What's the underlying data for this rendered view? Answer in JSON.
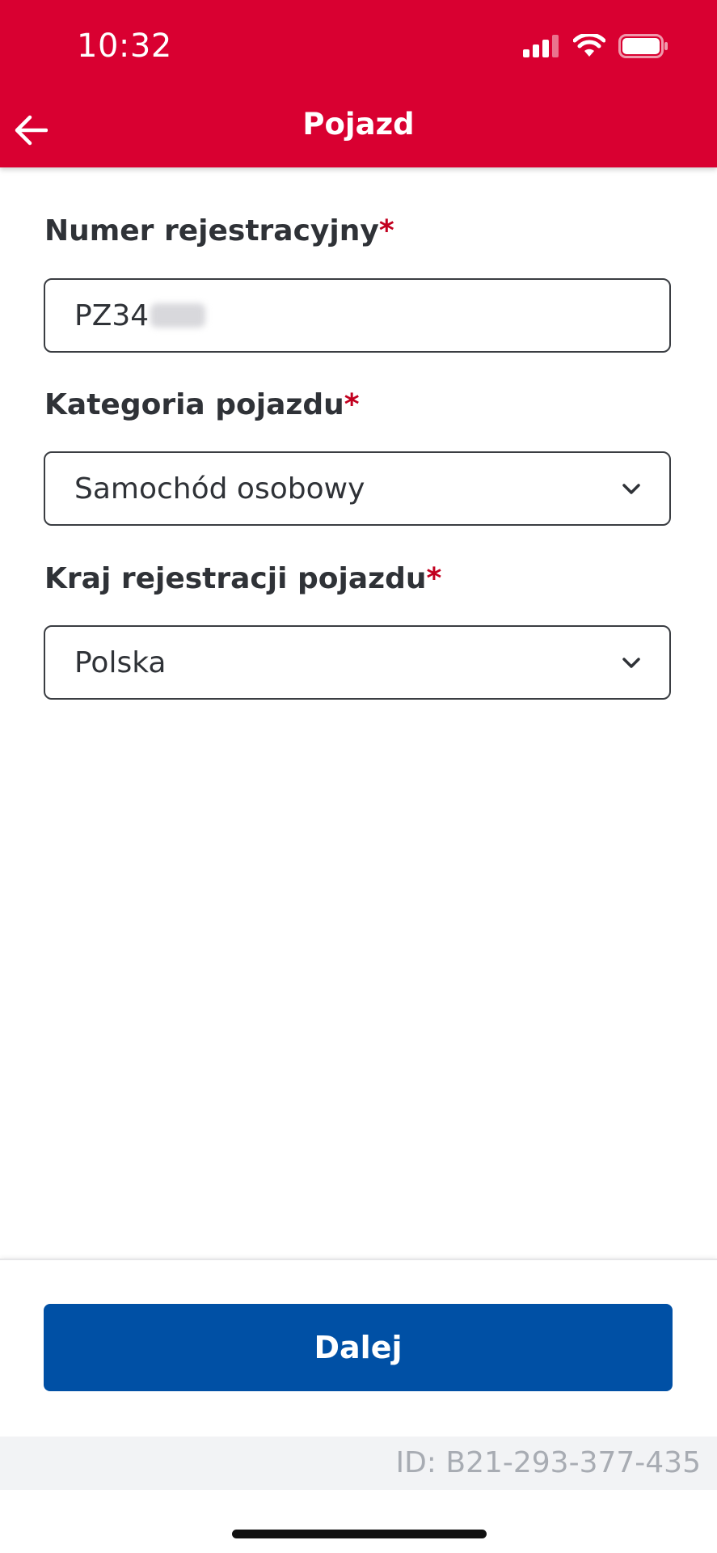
{
  "status_bar": {
    "time": "10:32"
  },
  "app_bar": {
    "title": "Pojazd",
    "back_icon": "arrow-left-icon"
  },
  "form": {
    "registration": {
      "label": "Numer rejestracyjny",
      "required_mark": "*",
      "value": "PZ34"
    },
    "category": {
      "label": "Kategoria pojazdu",
      "required_mark": "*",
      "selected": "Samochód osobowy"
    },
    "country": {
      "label": "Kraj rejestracji pojazdu",
      "required_mark": "*",
      "selected": "Polska"
    }
  },
  "footer": {
    "next_label": "Dalej",
    "id_text": "ID: B21-293-377-435"
  },
  "colors": {
    "header": "#d90031",
    "primary_button": "#0050a5",
    "required": "#c2001f"
  }
}
